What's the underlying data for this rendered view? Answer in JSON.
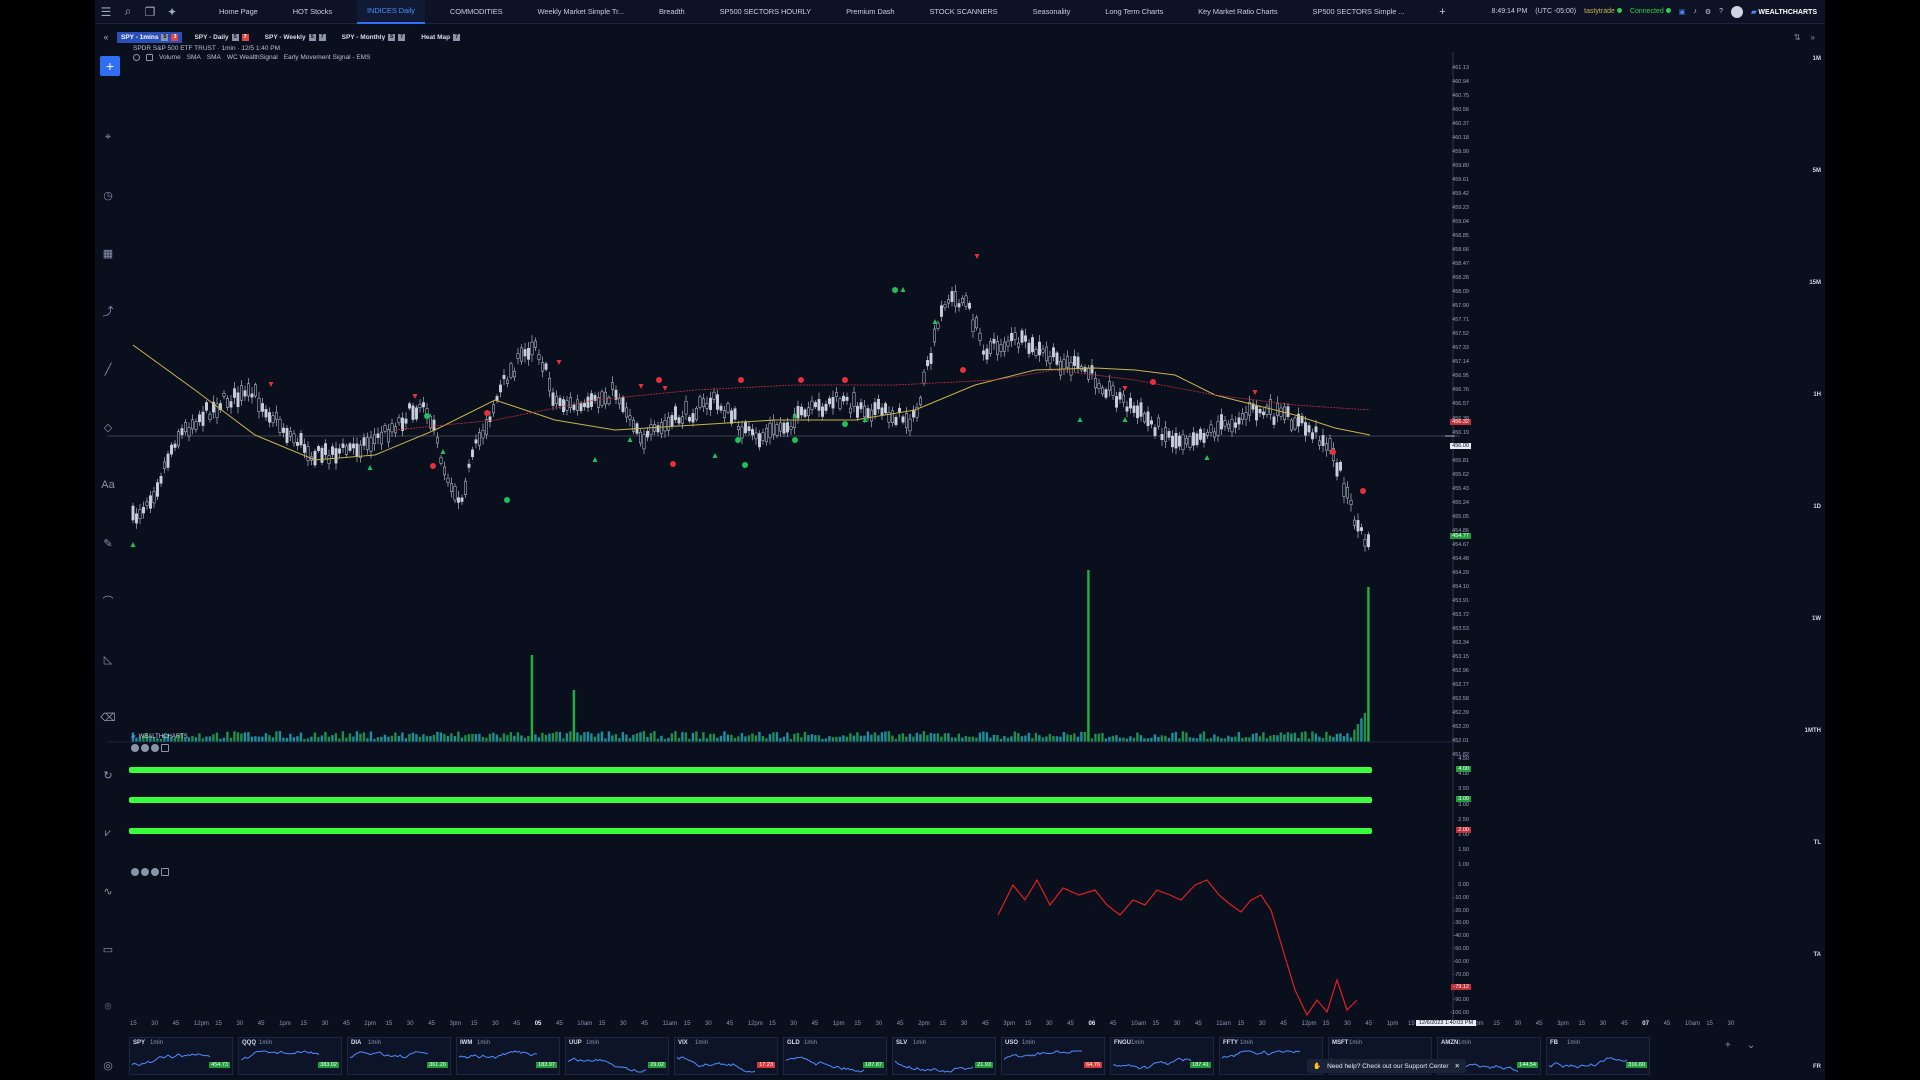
{
  "topbar": {
    "tabs": [
      {
        "label": "Home Page"
      },
      {
        "label": "HOT Stocks"
      },
      {
        "label": "INDICES Daily",
        "active": true
      },
      {
        "label": "COMMODITIES"
      },
      {
        "label": "Weekly Market Simple Tr..."
      },
      {
        "label": "Breadth"
      },
      {
        "label": "SP500 SECTORS HOURLY"
      },
      {
        "label": "Premium Dash"
      },
      {
        "label": "STOCK SCANNERS"
      },
      {
        "label": "Seasonality"
      },
      {
        "label": "Long Term Charts"
      },
      {
        "label": "Key Market Ratio Charts"
      },
      {
        "label": "SP500 SECTORS Simple ..."
      }
    ],
    "add_tab": "+",
    "time": "8:49:14 PM",
    "timezone": "(UTC -05:00)",
    "broker": "tastytrade",
    "status": "Connected",
    "brand": "WEALTHCHARTS"
  },
  "chart_tabs": [
    {
      "label": "SPY - 1mins",
      "active": true,
      "badges": [
        "S",
        "3"
      ]
    },
    {
      "label": "SPY - Daily",
      "badges": [
        "S",
        "7"
      ]
    },
    {
      "label": "SPY - Weekly",
      "badges": [
        "S",
        "7"
      ]
    },
    {
      "label": "SPY - Monthly",
      "badges": [
        "S",
        "7"
      ]
    },
    {
      "label": "Heat Map",
      "badges": [
        "7"
      ]
    }
  ],
  "symbol_line": "SPDR S&P 500 ETF TRUST · 1min · 12/5 1:40 PM",
  "indicators": [
    "Volume",
    "SMA",
    "SMA",
    "WC WealthSignal",
    "Early Movement Signal - EMS"
  ],
  "watermark": "WEALTHCHARTS",
  "timeframes": [
    "1M",
    "5M",
    "15M",
    "1H",
    "1D",
    "1W",
    "1MTH",
    "TL",
    "TA",
    "FR"
  ],
  "price_axis": [
    "461.13",
    "460.94",
    "460.75",
    "460.56",
    "460.37",
    "460.18",
    "459.99",
    "459.80",
    "459.61",
    "459.42",
    "459.23",
    "459.04",
    "458.85",
    "458.66",
    "458.47",
    "458.28",
    "458.09",
    "457.90",
    "457.71",
    "457.52",
    "457.33",
    "457.14",
    "456.95",
    "456.76",
    "456.57",
    "456.38",
    "456.19",
    "456.00",
    "455.81",
    "455.62",
    "455.43",
    "455.24",
    "455.05",
    "454.86",
    "454.67",
    "454.48",
    "454.29",
    "454.10",
    "453.91",
    "453.72",
    "453.53",
    "453.34",
    "453.15",
    "452.96",
    "452.77",
    "452.58",
    "452.39",
    "452.20",
    "452.01",
    "451.82"
  ],
  "price_badges": {
    "red": "456.32",
    "white": "456.00",
    "green": "454.77"
  },
  "signal_axis": [
    "4.50",
    "4.00",
    "3.50",
    "3.00",
    "2.50",
    "2.00",
    "1.50",
    "1.00"
  ],
  "signal_badges": {
    "a": "4.00",
    "b": "3.00",
    "c": "2.00"
  },
  "osc_axis": [
    "0.00",
    "-10.00",
    "-20.00",
    "-30.00",
    "-40.00",
    "-50.00",
    "-60.00",
    "-70.00",
    "-80.00",
    "-90.00",
    "-100.00"
  ],
  "osc_badge": "-79.12",
  "time_axis": [
    "15",
    "30",
    "45",
    "12pm",
    "15",
    "30",
    "45",
    "1pm",
    "15",
    "30",
    "45",
    "2pm",
    "15",
    "30",
    "45",
    "3pm",
    "15",
    "30",
    "45",
    "05",
    "45",
    "10am",
    "15",
    "30",
    "45",
    "11am",
    "15",
    "30",
    "45",
    "12pm",
    "15",
    "30",
    "45",
    "1pm",
    "15",
    "30",
    "45",
    "2pm",
    "15",
    "30",
    "45",
    "3pm",
    "15",
    "30",
    "45",
    "06",
    "45",
    "10am",
    "15",
    "30",
    "45",
    "11am",
    "15",
    "30",
    "45",
    "12pm",
    "15",
    "30",
    "45",
    "1pm",
    "15",
    "30",
    "45",
    "2pm",
    "15",
    "30",
    "45",
    "3pm",
    "15",
    "30",
    "45",
    "07",
    "45",
    "10am",
    "15",
    "30"
  ],
  "crosshair_date": "12/6/2023 1:40:03 PM",
  "minis": [
    {
      "symbol": "SPY",
      "tf": "1min",
      "value": "454.73",
      "color": "#1f9d3a"
    },
    {
      "symbol": "QQQ",
      "tf": "1min",
      "value": "383.02",
      "color": "#1f9d3a"
    },
    {
      "symbol": "DIA",
      "tf": "1min",
      "value": "361.20",
      "color": "#1f9d3a"
    },
    {
      "symbol": "IWM",
      "tf": "1min",
      "value": "183.97",
      "color": "#1f9d3a"
    },
    {
      "symbol": "UUP",
      "tf": "1min",
      "value": "29.02",
      "color": "#1f9d3a"
    },
    {
      "symbol": "VIX",
      "tf": "1min",
      "value": "17.23",
      "color": "#d83a3a"
    },
    {
      "symbol": "GLD",
      "tf": "1min",
      "value": "187.87",
      "color": "#1f9d3a"
    },
    {
      "symbol": "SLV",
      "tf": "1min",
      "value": "21.93",
      "color": "#1f9d3a"
    },
    {
      "symbol": "USO",
      "tf": "1min",
      "value": "64.76",
      "color": "#d83a3a"
    },
    {
      "symbol": "FNGU",
      "tf": "1min",
      "value": "187.41",
      "color": "#1f9d3a"
    },
    {
      "symbol": "FFTY",
      "tf": "1min",
      "value": "",
      "color": "#1f9d3a"
    },
    {
      "symbol": "MSFT",
      "tf": "1min",
      "value": "",
      "color": "#1f9d3a"
    },
    {
      "symbol": "AMZN",
      "tf": "1min",
      "value": "144.54",
      "color": "#1f9d3a"
    },
    {
      "symbol": "FB",
      "tf": "1min",
      "value": "316.60",
      "color": "#1f9d3a"
    }
  ],
  "support": "Need help? Check out our Support Center",
  "colors": {
    "bull": "#20c05a",
    "bear": "#e8303a",
    "volume": "#1b8f9a",
    "sma_yellow": "#c9b24a",
    "sma_red": "#c0303a",
    "signal": "#39ff3c",
    "osc": "#e02020"
  }
}
